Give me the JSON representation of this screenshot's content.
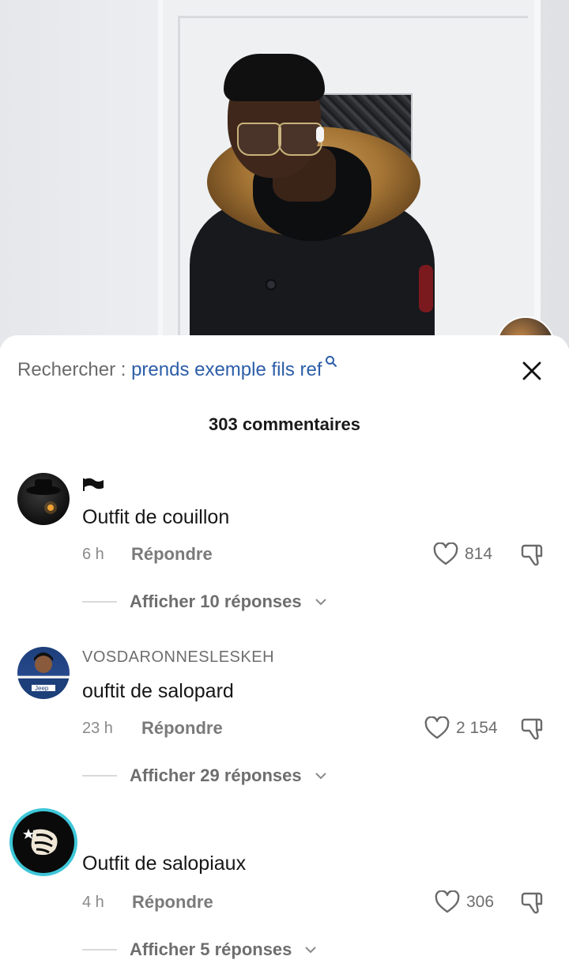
{
  "search": {
    "prefix": "Rechercher : ",
    "query": "prends exemple fils ref"
  },
  "comments_count": "303 commentaires",
  "comments": [
    {
      "username_icon": "black-flag-icon",
      "username": "",
      "text": "Outfit de couillon",
      "time": "6 h",
      "reply_label": "Répondre",
      "likes": "814",
      "replies_label": "Afficher 10 réponses"
    },
    {
      "username": "VOSDARONNESLESKEH",
      "text": "ouftit de salopard",
      "time": "23 h",
      "reply_label": "Répondre",
      "likes": "2 154",
      "replies_label": "Afficher 29 réponses"
    },
    {
      "username": "",
      "text": "Outfit de salopiaux",
      "time": "4 h",
      "reply_label": "Répondre",
      "likes": "306",
      "replies_label": "Afficher 5 réponses"
    }
  ],
  "colors": {
    "link_blue": "#2c5ea8",
    "text_dark": "#161616",
    "text_grey": "#6e6e6e",
    "accent_cyan": "#3ec7d8"
  }
}
